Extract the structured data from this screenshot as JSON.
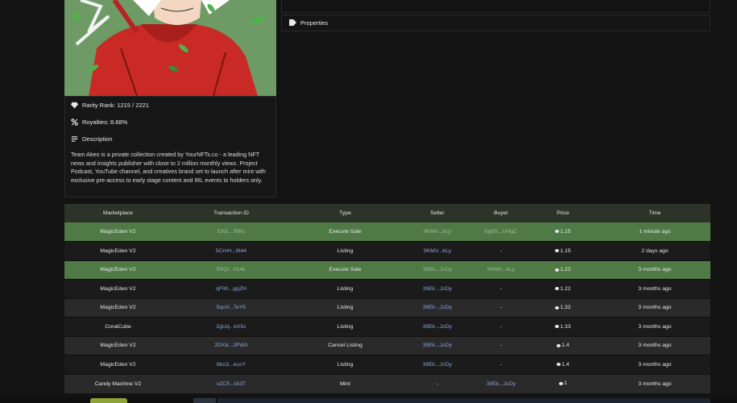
{
  "nft": {
    "rarity_rank": "Rarity Rank: 1215 / 2221",
    "royalties": "Royalties: 8.88%",
    "description_label": "Description",
    "description_text": "Team Akeo is a private collection created by YourNFTs.co - a leading NFT news and insights publisher with close to 2 million monthly views. Project Podcast, YouTube channel, and creatives brand set to launch after mint with exclusive pre-access to early stage content and IRL events to holders only."
  },
  "properties_label": "Properties",
  "icons": {
    "rarity": "diamond-icon",
    "royalties": "percent-icon",
    "description": "lines-icon",
    "properties": "tag-icon",
    "price": "solana-icon"
  },
  "colors": {
    "sale_row": "#4f7a45",
    "header_row": "#2c3328",
    "link": "#8aa6e0"
  },
  "table": {
    "headers": [
      "Marketplace",
      "Transaction ID",
      "Type",
      "Seller",
      "Buyer",
      "Price",
      "Time"
    ],
    "rows": [
      {
        "marketplace": "MagicEden V2",
        "tx": "53cL...f5Rc",
        "type": "Execute Sale",
        "seller": "9KMV...bLy",
        "buyer": "6g8S...UHgC",
        "price": "1.15",
        "time": "1 minute ago",
        "style": "sale"
      },
      {
        "marketplace": "MagicEden V2",
        "tx": "5CmH...9t44",
        "type": "Listing",
        "seller": "9KMV...bLy",
        "buyer": "-",
        "price": "1.15",
        "time": "2 days ago",
        "style": "even"
      },
      {
        "marketplace": "MagicEden V2",
        "tx": "5SQt...h14L",
        "type": "Execute Sale",
        "seller": "39Ek...JcDy",
        "buyer": "9KMV...bLy",
        "price": "1.22",
        "time": "3 months ago",
        "style": "sale"
      },
      {
        "marketplace": "MagicEden V2",
        "tx": "qF0h...gqZH",
        "type": "Listing",
        "seller": "39Ek...JcDy",
        "buyer": "-",
        "price": "1.22",
        "time": "3 months ago",
        "style": "even"
      },
      {
        "marketplace": "MagicEden V2",
        "tx": "5quV...TeY5",
        "type": "Listing",
        "seller": "39Ek...JcDy",
        "buyer": "-",
        "price": "1.32",
        "time": "3 months ago",
        "style": "odd"
      },
      {
        "marketplace": "CoralCube",
        "tx": "2gUq...kX5s",
        "type": "Listing",
        "seller": "39Ek...JcDy",
        "buyer": "-",
        "price": "1.33",
        "time": "3 months ago",
        "style": "even"
      },
      {
        "marketplace": "MagicEden V2",
        "tx": "2DXd...JPWA",
        "type": "Cancel Listing",
        "seller": "39Ek...JcDy",
        "buyer": "-",
        "price": "1.4",
        "time": "3 months ago",
        "style": "odd"
      },
      {
        "marketplace": "MagicEden V2",
        "tx": "8bo3...eusY",
        "type": "Listing",
        "seller": "39Ek...JcDy",
        "buyer": "-",
        "price": "1.4",
        "time": "3 months ago",
        "style": "even"
      },
      {
        "marketplace": "Candy Machine V2",
        "tx": "vZC5...tA3T",
        "type": "Mint",
        "seller": "-",
        "buyer": "39Ek...JcDy",
        "price": "1",
        "time": "3 months ago",
        "style": "odd"
      }
    ]
  }
}
